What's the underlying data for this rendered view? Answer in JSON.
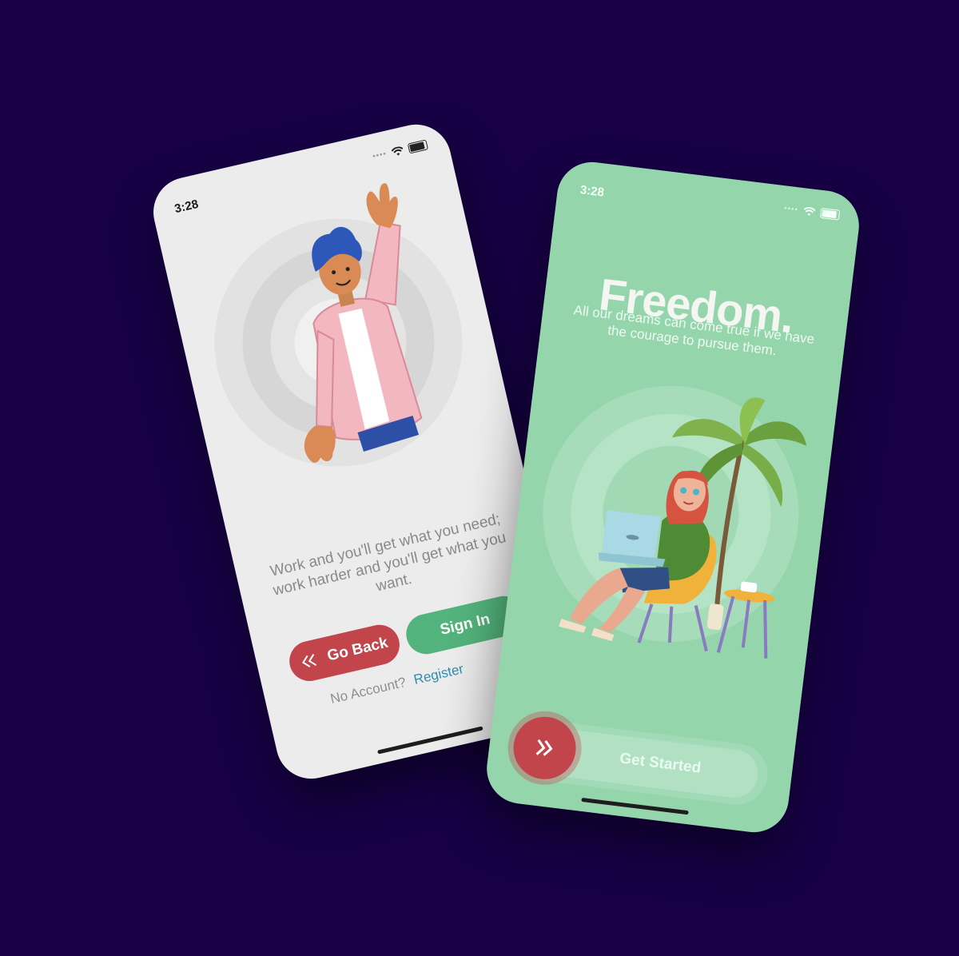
{
  "left_screen": {
    "status_time": "3:28",
    "quote": "Work and you'll get what you need; work harder and you'll get what you want.",
    "go_back_label": "Go Back",
    "sign_in_label": "Sign In",
    "no_account_text": "No Account?",
    "register_link": "Register"
  },
  "right_screen": {
    "status_time": "3:28",
    "headline": "Freedom.",
    "subline": "All our dreams can come true if we have the courage to pursue them.",
    "get_started_label": "Get Started"
  },
  "colors": {
    "background": "#170046",
    "accent_red": "#c2454c",
    "accent_green": "#53b37c",
    "mint": "#95d5ac"
  },
  "icons": [
    "wifi-icon",
    "battery-icon",
    "double-chevron-left-icon",
    "double-chevron-right-icon"
  ]
}
